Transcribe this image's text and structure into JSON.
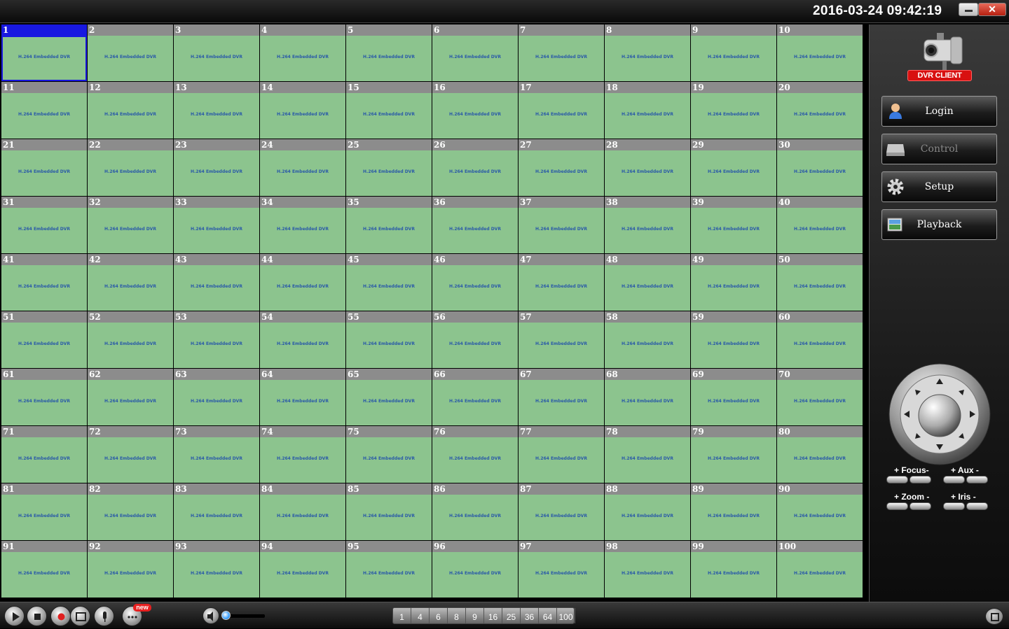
{
  "titlebar": {
    "datetime": "2016-03-24 09:42:19",
    "minimize_icon": "minimize-icon",
    "close_label": "✕"
  },
  "grid": {
    "placeholder_text": "H.264 Embedded DVR",
    "selected_channel": 1,
    "channels": [
      "1",
      "2",
      "3",
      "4",
      "5",
      "6",
      "7",
      "8",
      "9",
      "10",
      "11",
      "12",
      "13",
      "14",
      "15",
      "16",
      "17",
      "18",
      "19",
      "20",
      "21",
      "22",
      "23",
      "24",
      "25",
      "26",
      "27",
      "28",
      "29",
      "30",
      "31",
      "32",
      "33",
      "34",
      "35",
      "36",
      "37",
      "38",
      "39",
      "40",
      "41",
      "42",
      "43",
      "44",
      "45",
      "46",
      "47",
      "48",
      "49",
      "50",
      "51",
      "52",
      "53",
      "54",
      "55",
      "56",
      "57",
      "58",
      "59",
      "60",
      "61",
      "62",
      "63",
      "64",
      "65",
      "66",
      "67",
      "68",
      "69",
      "70",
      "71",
      "72",
      "73",
      "74",
      "75",
      "76",
      "77",
      "78",
      "79",
      "80",
      "81",
      "82",
      "83",
      "84",
      "85",
      "86",
      "87",
      "88",
      "89",
      "90",
      "91",
      "92",
      "93",
      "94",
      "95",
      "96",
      "97",
      "98",
      "99",
      "100"
    ],
    "colors": {
      "header": "#8c8c8c",
      "video": "#8cc48e",
      "selected": "#1818e0"
    }
  },
  "sidebar": {
    "logo_text": "DVR CLIENT",
    "buttons": [
      {
        "label": "Login",
        "icon": "user-icon",
        "enabled": true
      },
      {
        "label": "Control",
        "icon": "control-icon",
        "enabled": false
      },
      {
        "label": "Setup",
        "icon": "gear-icon",
        "enabled": true
      },
      {
        "label": "Playback",
        "icon": "playback-icon",
        "enabled": true
      }
    ],
    "ptz": {
      "focus_label": "+ Focus-",
      "aux_label": "+ Aux  -",
      "zoom_label": "+ Zoom -",
      "iris_label": "+ Iris -"
    }
  },
  "bottombar": {
    "new_badge": "new",
    "volume_level": 0.05,
    "split_options": [
      "1",
      "4",
      "6",
      "8",
      "9",
      "16",
      "25",
      "36",
      "64",
      "100"
    ]
  }
}
